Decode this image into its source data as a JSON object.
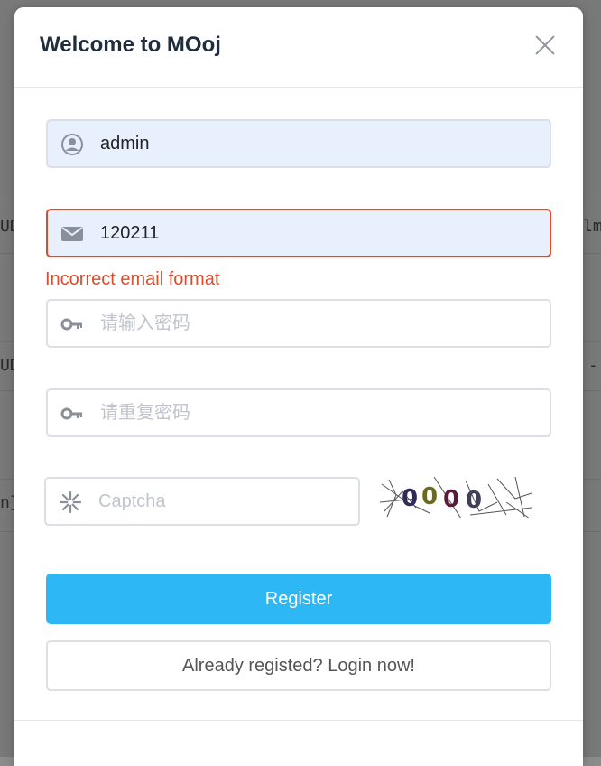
{
  "dialog": {
    "title": "Welcome to MOoj"
  },
  "form": {
    "username": {
      "value": "admin",
      "icon": "user-icon"
    },
    "email": {
      "value": "120211",
      "icon": "mail-icon",
      "error": "Incorrect email format"
    },
    "password": {
      "placeholder": "请输入密码",
      "icon": "key-icon"
    },
    "password_repeat": {
      "placeholder": "请重复密码",
      "icon": "key-icon"
    },
    "captcha": {
      "placeholder": "Captcha",
      "icon": "snowflake-icon"
    }
  },
  "buttons": {
    "register": "Register",
    "login": "Already registed? Login now!"
  },
  "colors": {
    "accent": "#2db7f5",
    "error": "#e04b2c",
    "autofill": "#e8f0fe"
  }
}
